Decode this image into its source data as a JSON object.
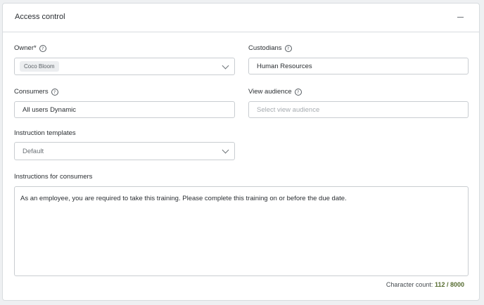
{
  "panel": {
    "title": "Access control",
    "collapse_icon": "minus-icon"
  },
  "owner": {
    "label": "Owner*",
    "chip": "Coco Bloom",
    "help_icon": "help-circle-icon"
  },
  "custodians": {
    "label": "Custodians",
    "value": "Human Resources",
    "help_icon": "help-circle-icon"
  },
  "consumers": {
    "label": "Consumers",
    "value": "All users Dynamic",
    "help_icon": "help-circle-icon"
  },
  "view_audience": {
    "label": "View audience",
    "placeholder": "Select view audience",
    "help_icon": "help-circle-icon"
  },
  "instruction_templates": {
    "label": "Instruction templates",
    "value": "Default"
  },
  "instructions": {
    "label": "Instructions for consumers",
    "text": "As an employee, you are required to take this training. Please complete this training on or before the due date."
  },
  "character_count": {
    "label": "Character count:",
    "value": "112 / 8000"
  }
}
